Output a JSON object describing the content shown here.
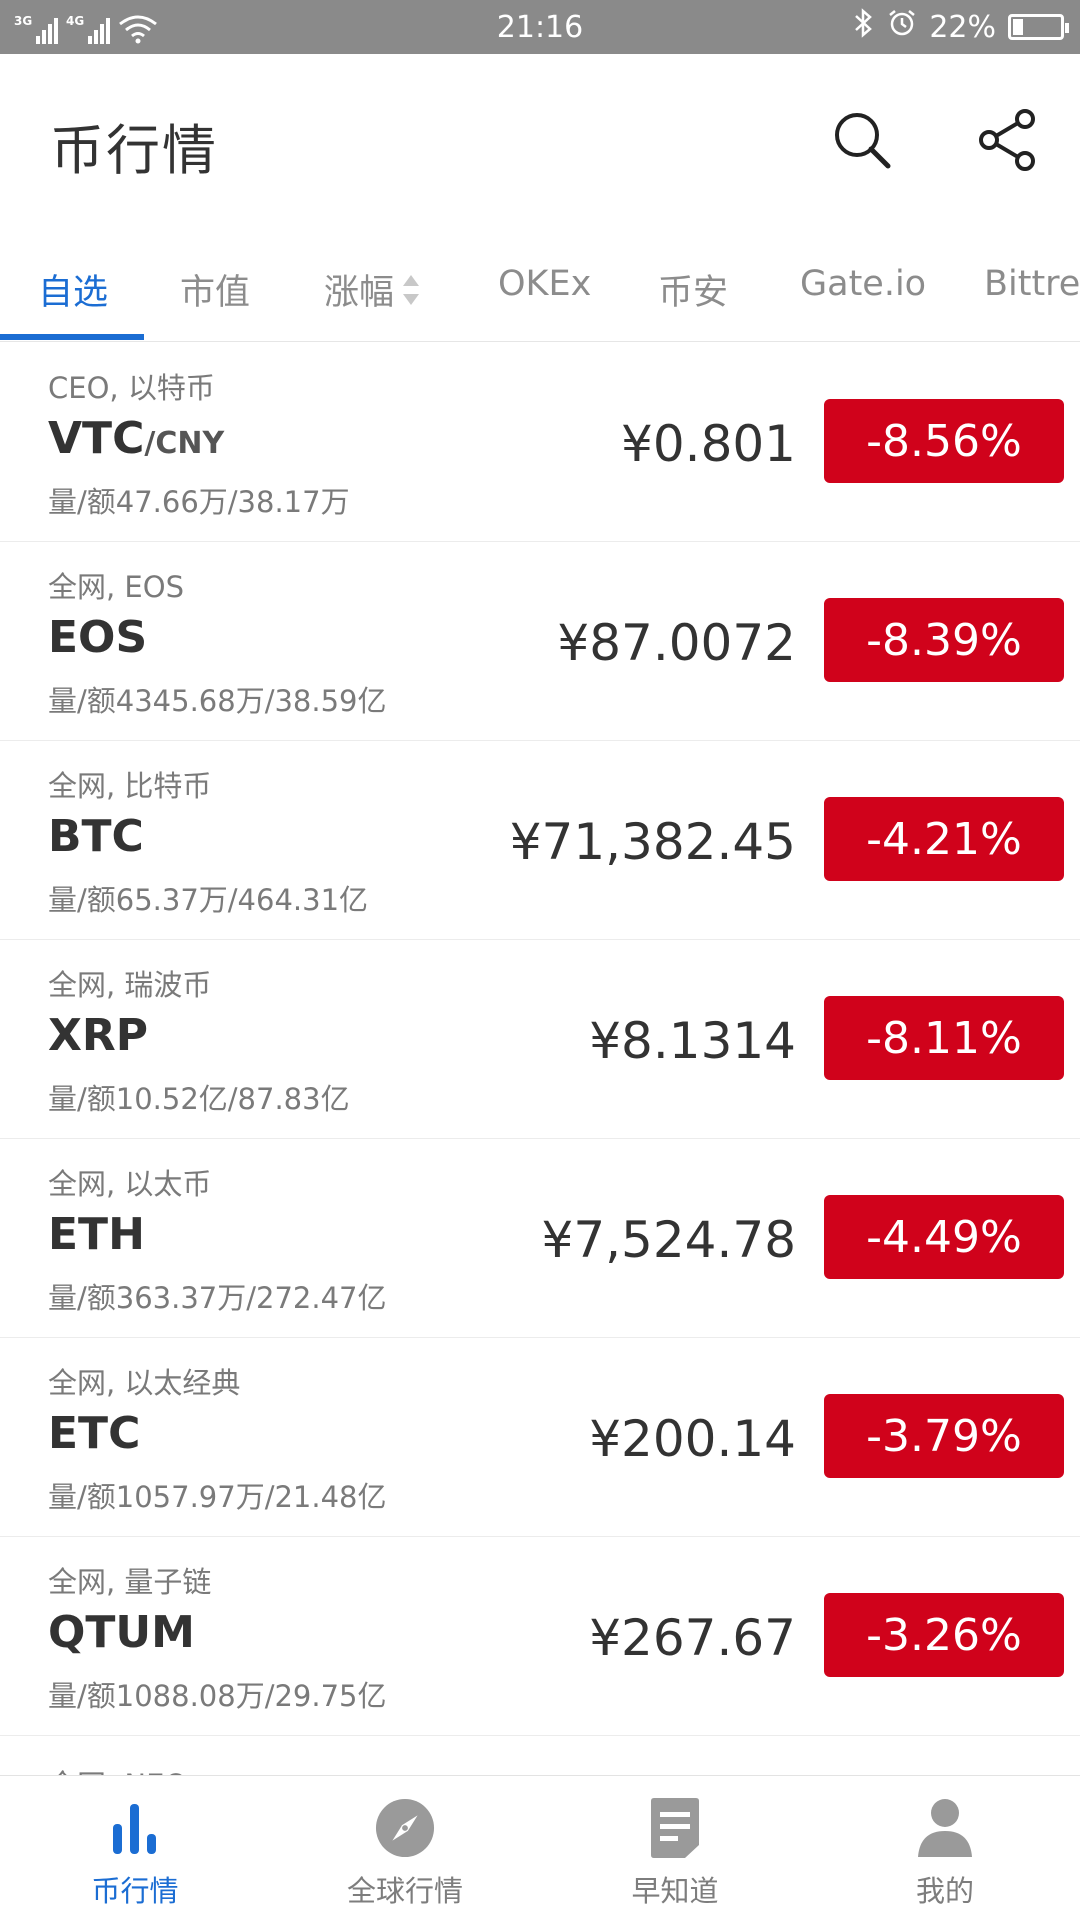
{
  "status_bar": {
    "network_1": "3G",
    "network_2": "4G",
    "time": "21:16",
    "battery_text": "22%",
    "battery_level": 0.22
  },
  "header": {
    "title": "币行情",
    "search_icon": "search-icon",
    "share_icon": "share-icon"
  },
  "tabs": [
    {
      "label": "自选",
      "active": true
    },
    {
      "label": "市值"
    },
    {
      "label": "涨幅"
    },
    {
      "label": "OKEx"
    },
    {
      "label": "币安"
    },
    {
      "label": "Gate.io"
    },
    {
      "label": "Bittrex"
    }
  ],
  "coins": [
    {
      "subtitle": "CEO, 以特币",
      "symbol": "VTC",
      "quote": "/CNY",
      "volume": "量/额47.66万/38.17万",
      "price": "¥0.801",
      "change": "-8.56%"
    },
    {
      "subtitle": "全网, EOS",
      "symbol": "EOS",
      "quote": "",
      "volume": "量/额4345.68万/38.59亿",
      "price": "¥87.0072",
      "change": "-8.39%"
    },
    {
      "subtitle": "全网, 比特币",
      "symbol": "BTC",
      "quote": "",
      "volume": "量/额65.37万/464.31亿",
      "price": "¥71,382.45",
      "change": "-4.21%"
    },
    {
      "subtitle": "全网, 瑞波币",
      "symbol": "XRP",
      "quote": "",
      "volume": "量/额10.52亿/87.83亿",
      "price": "¥8.1314",
      "change": "-8.11%"
    },
    {
      "subtitle": "全网, 以太币",
      "symbol": "ETH",
      "quote": "",
      "volume": "量/额363.37万/272.47亿",
      "price": "¥7,524.78",
      "change": "-4.49%"
    },
    {
      "subtitle": "全网, 以太经典",
      "symbol": "ETC",
      "quote": "",
      "volume": "量/额1057.97万/21.48亿",
      "price": "¥200.14",
      "change": "-3.79%"
    },
    {
      "subtitle": "全网, 量子链",
      "symbol": "QTUM",
      "quote": "",
      "volume": "量/额1088.08万/29.75亿",
      "price": "¥267.67",
      "change": "-3.26%"
    }
  ],
  "partial_row": {
    "subtitle": "全网, NEO"
  },
  "colors": {
    "accent": "#1b6dd3",
    "down": "#d0021b",
    "status_bar": "#8a8a8a"
  },
  "bottom_nav": [
    {
      "label": "币行情",
      "icon": "bar-chart-icon",
      "active": true
    },
    {
      "label": "全球行情",
      "icon": "compass-icon"
    },
    {
      "label": "早知道",
      "icon": "document-icon"
    },
    {
      "label": "我的",
      "icon": "user-icon"
    }
  ]
}
